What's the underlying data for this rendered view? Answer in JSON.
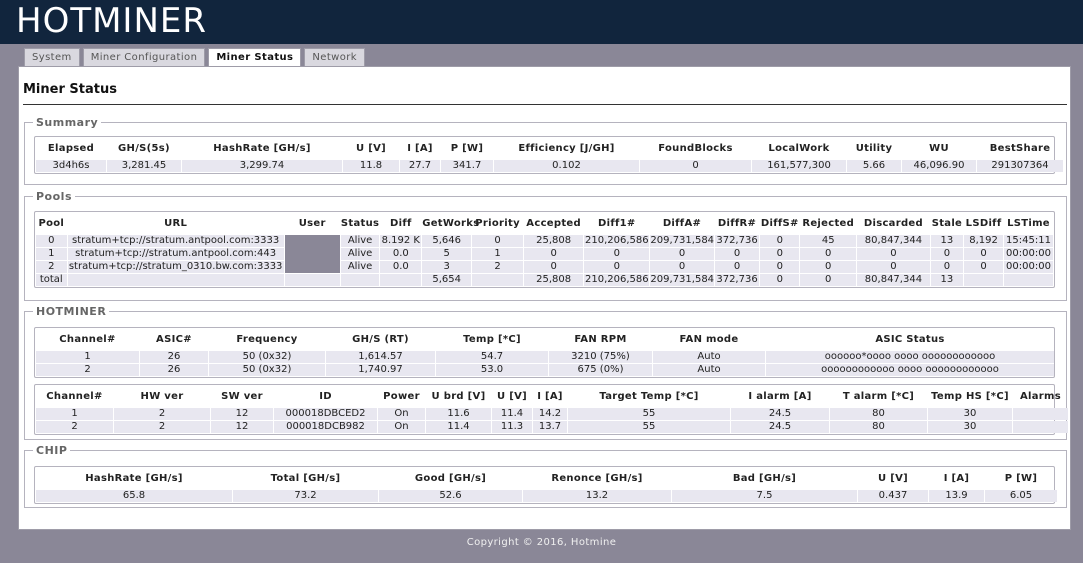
{
  "app": {
    "logo": "HOTMINER"
  },
  "tabs": [
    {
      "label": "System"
    },
    {
      "label": "Miner Configuration"
    },
    {
      "label": "Miner Status"
    },
    {
      "label": "Network"
    }
  ],
  "page_title": "Miner Status",
  "summary": {
    "legend": "Summary",
    "headers": [
      "Elapsed",
      "GH/S(5s)",
      "HashRate [GH/s]",
      "U [V]",
      "I [A]",
      "P [W]",
      "Efficiency [J/GH]",
      "FoundBlocks",
      "LocalWork",
      "Utility",
      "WU",
      "BestShare"
    ],
    "row": [
      "3d4h6s",
      "3,281.45",
      "3,299.74",
      "11.8",
      "27.7",
      "341.7",
      "0.102",
      "0",
      "161,577,300",
      "5.66",
      "46,096.90",
      "291307364"
    ]
  },
  "pools": {
    "legend": "Pools",
    "headers": [
      "Pool",
      "URL",
      "User",
      "Status",
      "Diff",
      "GetWorks",
      "Priority",
      "Accepted",
      "Diff1#",
      "DiffA#",
      "DiffR#",
      "DiffS#",
      "Rejected",
      "Discarded",
      "Stale",
      "LSDiff",
      "LSTime"
    ],
    "rows": [
      [
        "0",
        "stratum+tcp://stratum.antpool.com:3333",
        "",
        "Alive",
        "8.192 K",
        "5,646",
        "0",
        "25,808",
        "210,206,586",
        "209,731,584",
        "372,736",
        "0",
        "45",
        "80,847,344",
        "13",
        "8,192",
        "15:45:11"
      ],
      [
        "1",
        "stratum+tcp://stratum.antpool.com:443",
        "",
        "Alive",
        "0.0",
        "5",
        "1",
        "0",
        "0",
        "0",
        "0",
        "0",
        "0",
        "0",
        "0",
        "0",
        "00:00:00"
      ],
      [
        "2",
        "stratum+tcp://stratum_0310.bw.com:3333",
        "",
        "Alive",
        "0.0",
        "3",
        "2",
        "0",
        "0",
        "0",
        "0",
        "0",
        "0",
        "0",
        "0",
        "0",
        "00:00:00"
      ],
      [
        "total",
        "",
        "",
        "",
        "",
        "5,654",
        "",
        "25,808",
        "210,206,586",
        "209,731,584",
        "372,736",
        "0",
        "0",
        "80,847,344",
        "13",
        "",
        ""
      ]
    ]
  },
  "hotminer": {
    "legend": "HOTMINER",
    "table1": {
      "headers": [
        "Channel#",
        "ASIC#",
        "Frequency",
        "GH/S (RT)",
        "Temp [*C]",
        "FAN RPM",
        "FAN mode",
        "ASIC Status"
      ],
      "rows": [
        [
          "1",
          "26",
          "50 (0x32)",
          "1,614.57",
          "54.7",
          "3210 (75%)",
          "Auto",
          "oooooo*oooo oooo oooooooooooo"
        ],
        [
          "2",
          "26",
          "50 (0x32)",
          "1,740.97",
          "53.0",
          "675 (0%)",
          "Auto",
          "oooooooooooo oooo oooooooooooo"
        ]
      ]
    },
    "table2": {
      "headers": [
        "Channel#",
        "HW ver",
        "SW ver",
        "ID",
        "Power",
        "U brd [V]",
        "U [V]",
        "I [A]",
        "Target Temp [*C]",
        "I alarm [A]",
        "T alarm [*C]",
        "Temp HS [*C]",
        "Alarms"
      ],
      "rows": [
        [
          "1",
          "2",
          "12",
          "000018DBCED2",
          "On",
          "11.6",
          "11.4",
          "14.2",
          "55",
          "24.5",
          "80",
          "30",
          ""
        ],
        [
          "2",
          "2",
          "12",
          "000018DCB982",
          "On",
          "11.4",
          "11.3",
          "13.7",
          "55",
          "24.5",
          "80",
          "30",
          ""
        ]
      ]
    }
  },
  "chip": {
    "legend": "CHIP",
    "headers": [
      "HashRate [GH/s]",
      "Total [GH/s]",
      "Good [GH/s]",
      "Renonce [GH/s]",
      "Bad [GH/s]",
      "U [V]",
      "I [A]",
      "P [W]"
    ],
    "row": [
      "65.8",
      "73.2",
      "52.6",
      "13.2",
      "7.5",
      "0.437",
      "13.9",
      "6.05"
    ]
  },
  "footer": "Copyright © 2016, Hotmine"
}
